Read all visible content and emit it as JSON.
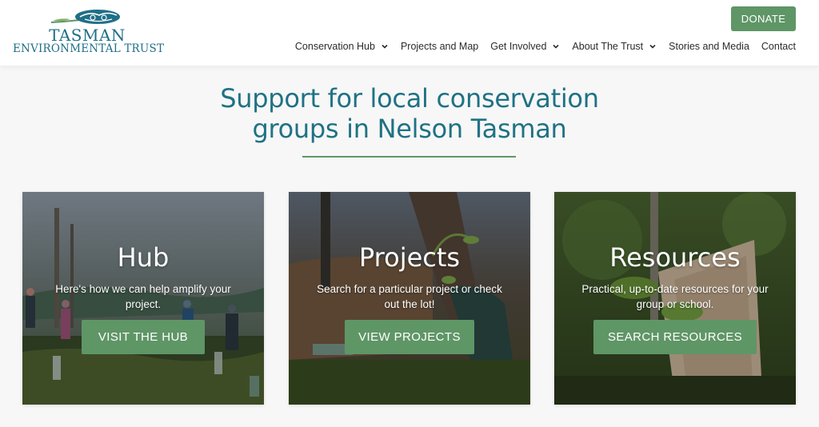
{
  "logo": {
    "line1": "TASMAN",
    "line2": "ENVIRONMENTAL TRUST"
  },
  "header": {
    "donate_label": "DONATE"
  },
  "nav": [
    {
      "label": "Conservation Hub",
      "dropdown": true
    },
    {
      "label": "Projects and Map",
      "dropdown": false
    },
    {
      "label": "Get Involved",
      "dropdown": true
    },
    {
      "label": "About The Trust",
      "dropdown": true
    },
    {
      "label": "Stories and Media",
      "dropdown": false
    },
    {
      "label": "Contact",
      "dropdown": false
    }
  ],
  "hero": {
    "headline_line1": "Support for local conservation",
    "headline_line2": "groups in Nelson Tasman"
  },
  "cards": [
    {
      "title": "Hub",
      "description": "Here's how we can help amplify your project.",
      "button": "VISIT THE HUB"
    },
    {
      "title": "Projects",
      "description": "Search for a particular project or check out the lot!",
      "button": "VIEW PROJECTS"
    },
    {
      "title": "Resources",
      "description": "Practical, up-to-date resources for your group or school.",
      "button": "SEARCH RESOURCES"
    }
  ],
  "colors": {
    "brand_teal": "#1f7284",
    "accent_green": "#5f9666"
  }
}
